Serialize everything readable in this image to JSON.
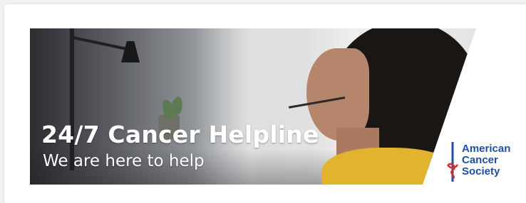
{
  "banner": {
    "headline": "24/7 Cancer Helpline",
    "subline": "We are here to help"
  },
  "logo": {
    "line1": "American",
    "line2": "Cancer",
    "line3": "Society",
    "mark_icon": "torch-sword-icon",
    "brand_color": "#1d50a2",
    "accent_color": "#d62e2e"
  },
  "colors": {
    "page_background": "#f1f1f1",
    "card_background": "#ffffff",
    "shirt": "#e2b42d"
  }
}
